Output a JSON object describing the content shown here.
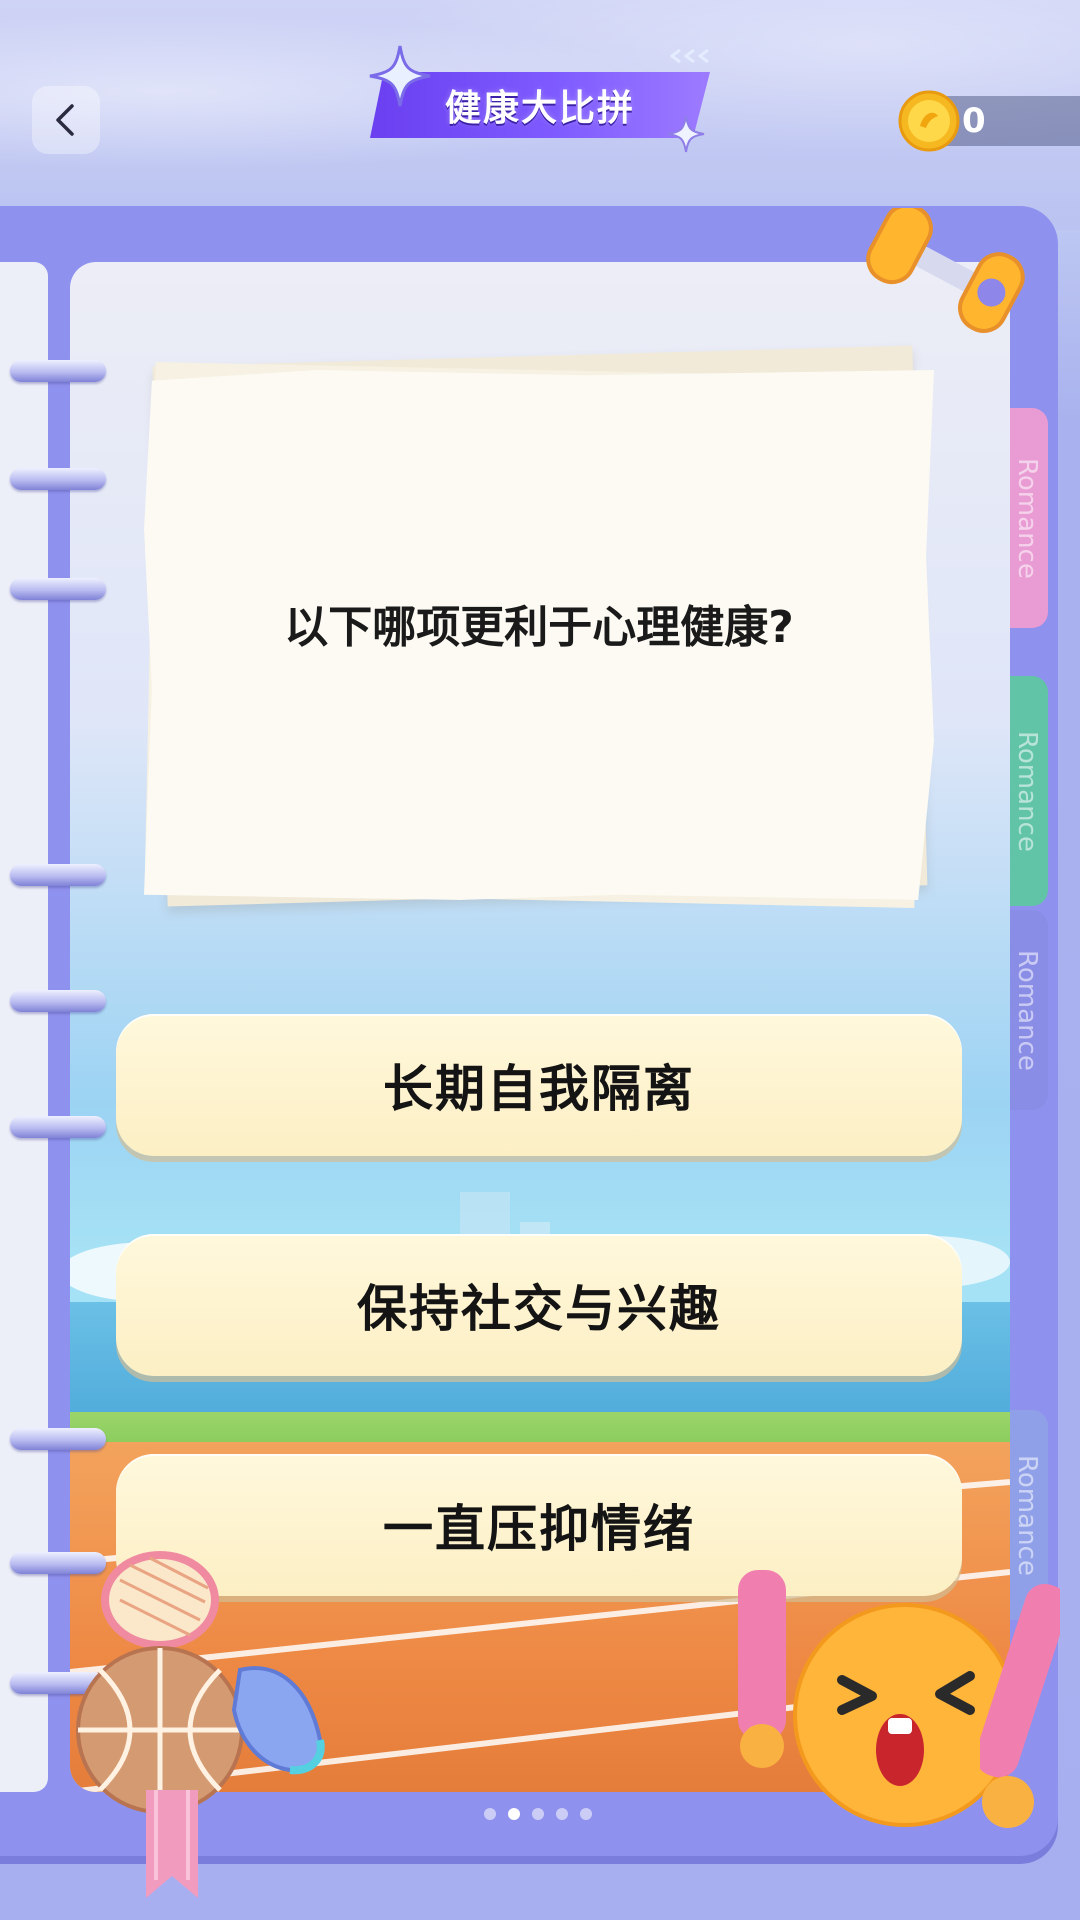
{
  "header": {
    "title": "健康大比拼",
    "coins": "0"
  },
  "quiz": {
    "question": "以下哪项更利于心理健康?",
    "options": [
      {
        "label": "长期自我隔离"
      },
      {
        "label": "保持社交与兴趣"
      },
      {
        "label": "一直压抑情绪"
      }
    ]
  },
  "tabs": [
    {
      "label": "Romance",
      "color": "#e99bd3"
    },
    {
      "label": "Romance",
      "color": "#61c4a6"
    },
    {
      "label": "Romance",
      "color": "#8a8de6"
    },
    {
      "label": "Romance",
      "color": "#8fa0e8"
    }
  ],
  "pager": {
    "total": 5,
    "active_index": 1
  },
  "icons": [
    "back-icon",
    "coin-icon",
    "sparkle-icon",
    "dumbbell-icon",
    "basketball-icon",
    "racket-icon",
    "shoe-icon",
    "emoji-ball-icon"
  ]
}
